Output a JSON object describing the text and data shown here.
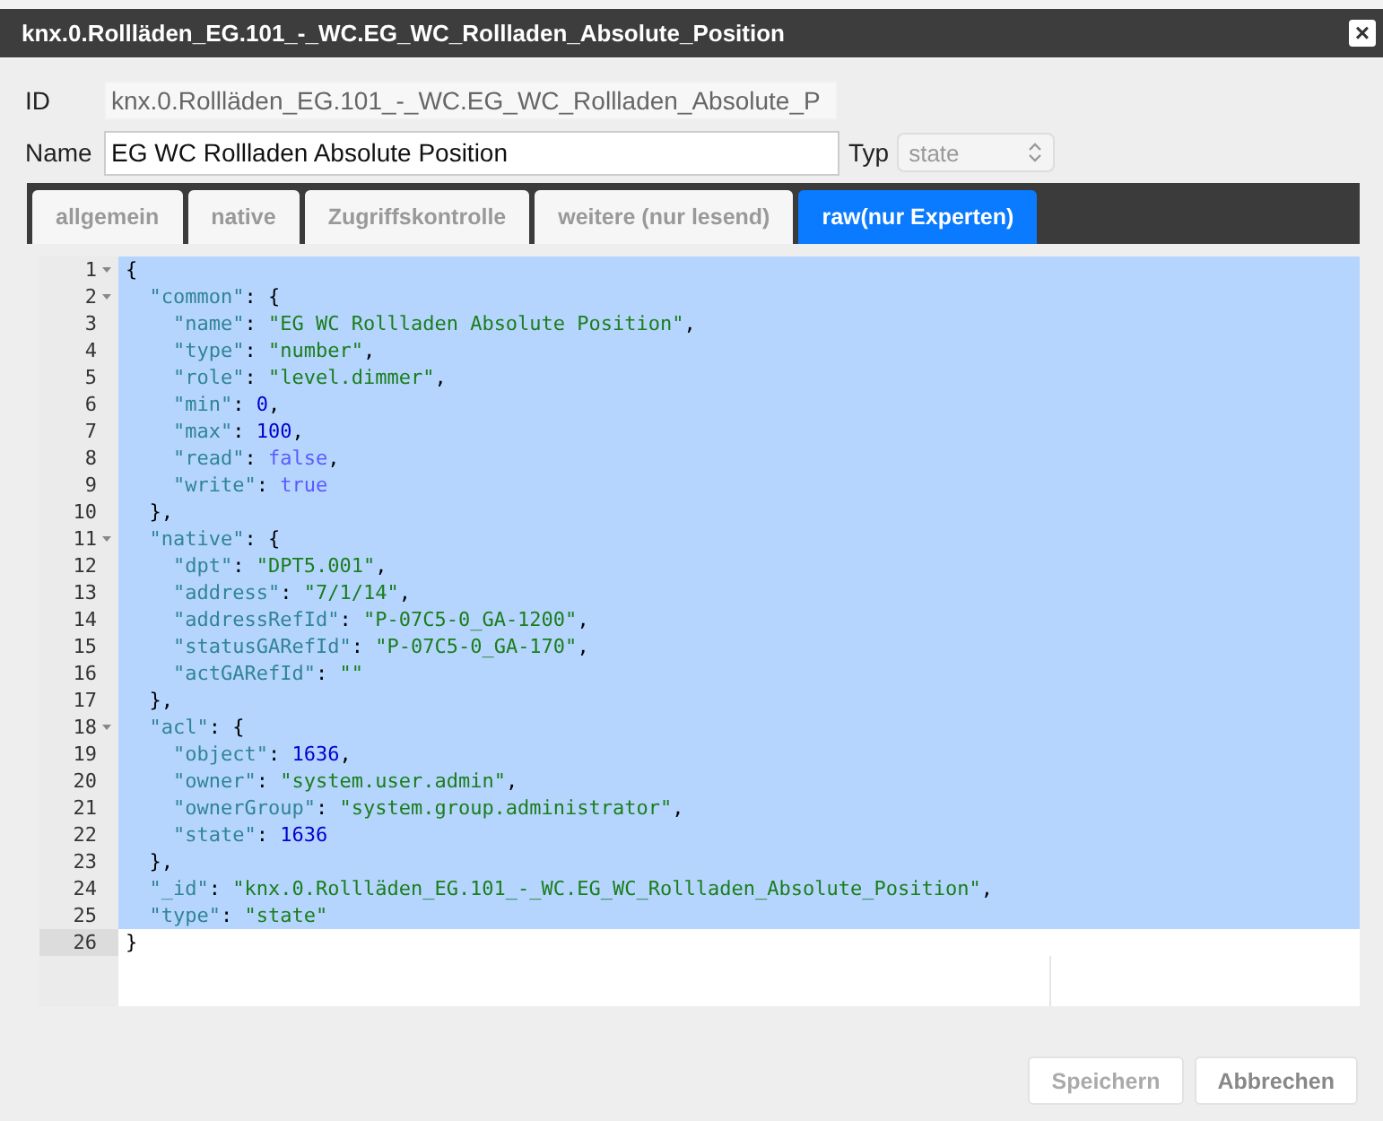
{
  "window": {
    "title": "knx.0.Rollläden_EG.101_-_WC.EG_WC_Rollladen_Absolute_Position",
    "close": "×"
  },
  "id_field": {
    "label": "ID",
    "value": "knx.0.Rollläden_EG.101_-_WC.EG_WC_Rollladen_Absolute_P"
  },
  "name_field": {
    "label": "Name",
    "value": "EG WC Rollladen Absolute Position"
  },
  "type_select": {
    "label": "Typ",
    "value": "state"
  },
  "tabs": [
    {
      "label": "allgemein",
      "selected": false
    },
    {
      "label": "native",
      "selected": false
    },
    {
      "label": "Zugriffskontrolle",
      "selected": false
    },
    {
      "label": "weitere (nur lesend)",
      "selected": false
    },
    {
      "label": "raw(nur Experten)",
      "selected": true
    }
  ],
  "editor": {
    "lines": [
      {
        "number": "1",
        "fold": true,
        "selected": true,
        "current": false,
        "tokens": [
          {
            "kind": "punct",
            "text": "{"
          }
        ]
      },
      {
        "number": "2",
        "fold": true,
        "selected": true,
        "current": false,
        "tokens": [
          {
            "kind": "key",
            "text": "  \"common\""
          },
          {
            "kind": "punct",
            "text": ": {"
          }
        ]
      },
      {
        "number": "3",
        "fold": false,
        "selected": true,
        "current": false,
        "tokens": [
          {
            "kind": "key",
            "text": "    \"name\""
          },
          {
            "kind": "punct",
            "text": ": "
          },
          {
            "kind": "string",
            "text": "\"EG WC Rollladen Absolute Position\""
          },
          {
            "kind": "punct",
            "text": ","
          }
        ]
      },
      {
        "number": "4",
        "fold": false,
        "selected": true,
        "current": false,
        "tokens": [
          {
            "kind": "key",
            "text": "    \"type\""
          },
          {
            "kind": "punct",
            "text": ": "
          },
          {
            "kind": "string",
            "text": "\"number\""
          },
          {
            "kind": "punct",
            "text": ","
          }
        ]
      },
      {
        "number": "5",
        "fold": false,
        "selected": true,
        "current": false,
        "tokens": [
          {
            "kind": "key",
            "text": "    \"role\""
          },
          {
            "kind": "punct",
            "text": ": "
          },
          {
            "kind": "string",
            "text": "\"level.dimmer\""
          },
          {
            "kind": "punct",
            "text": ","
          }
        ]
      },
      {
        "number": "6",
        "fold": false,
        "selected": true,
        "current": false,
        "tokens": [
          {
            "kind": "key",
            "text": "    \"min\""
          },
          {
            "kind": "punct",
            "text": ": "
          },
          {
            "kind": "number",
            "text": "0"
          },
          {
            "kind": "punct",
            "text": ","
          }
        ]
      },
      {
        "number": "7",
        "fold": false,
        "selected": true,
        "current": false,
        "tokens": [
          {
            "kind": "key",
            "text": "    \"max\""
          },
          {
            "kind": "punct",
            "text": ": "
          },
          {
            "kind": "number",
            "text": "100"
          },
          {
            "kind": "punct",
            "text": ","
          }
        ]
      },
      {
        "number": "8",
        "fold": false,
        "selected": true,
        "current": false,
        "tokens": [
          {
            "kind": "key",
            "text": "    \"read\""
          },
          {
            "kind": "punct",
            "text": ": "
          },
          {
            "kind": "bool",
            "text": "false"
          },
          {
            "kind": "punct",
            "text": ","
          }
        ]
      },
      {
        "number": "9",
        "fold": false,
        "selected": true,
        "current": false,
        "tokens": [
          {
            "kind": "key",
            "text": "    \"write\""
          },
          {
            "kind": "punct",
            "text": ": "
          },
          {
            "kind": "bool",
            "text": "true"
          }
        ]
      },
      {
        "number": "10",
        "fold": false,
        "selected": true,
        "current": false,
        "tokens": [
          {
            "kind": "punct",
            "text": "  },"
          }
        ]
      },
      {
        "number": "11",
        "fold": true,
        "selected": true,
        "current": false,
        "tokens": [
          {
            "kind": "key",
            "text": "  \"native\""
          },
          {
            "kind": "punct",
            "text": ": {"
          }
        ]
      },
      {
        "number": "12",
        "fold": false,
        "selected": true,
        "current": false,
        "tokens": [
          {
            "kind": "key",
            "text": "    \"dpt\""
          },
          {
            "kind": "punct",
            "text": ": "
          },
          {
            "kind": "string",
            "text": "\"DPT5.001\""
          },
          {
            "kind": "punct",
            "text": ","
          }
        ]
      },
      {
        "number": "13",
        "fold": false,
        "selected": true,
        "current": false,
        "tokens": [
          {
            "kind": "key",
            "text": "    \"address\""
          },
          {
            "kind": "punct",
            "text": ": "
          },
          {
            "kind": "string",
            "text": "\"7/1/14\""
          },
          {
            "kind": "punct",
            "text": ","
          }
        ]
      },
      {
        "number": "14",
        "fold": false,
        "selected": true,
        "current": false,
        "tokens": [
          {
            "kind": "key",
            "text": "    \"addressRefId\""
          },
          {
            "kind": "punct",
            "text": ": "
          },
          {
            "kind": "string",
            "text": "\"P-07C5-0_GA-1200\""
          },
          {
            "kind": "punct",
            "text": ","
          }
        ]
      },
      {
        "number": "15",
        "fold": false,
        "selected": true,
        "current": false,
        "tokens": [
          {
            "kind": "key",
            "text": "    \"statusGARefId\""
          },
          {
            "kind": "punct",
            "text": ": "
          },
          {
            "kind": "string",
            "text": "\"P-07C5-0_GA-170\""
          },
          {
            "kind": "punct",
            "text": ","
          }
        ]
      },
      {
        "number": "16",
        "fold": false,
        "selected": true,
        "current": false,
        "tokens": [
          {
            "kind": "key",
            "text": "    \"actGARefId\""
          },
          {
            "kind": "punct",
            "text": ": "
          },
          {
            "kind": "string",
            "text": "\"\""
          }
        ]
      },
      {
        "number": "17",
        "fold": false,
        "selected": true,
        "current": false,
        "tokens": [
          {
            "kind": "punct",
            "text": "  },"
          }
        ]
      },
      {
        "number": "18",
        "fold": true,
        "selected": true,
        "current": false,
        "tokens": [
          {
            "kind": "key",
            "text": "  \"acl\""
          },
          {
            "kind": "punct",
            "text": ": {"
          }
        ]
      },
      {
        "number": "19",
        "fold": false,
        "selected": true,
        "current": false,
        "tokens": [
          {
            "kind": "key",
            "text": "    \"object\""
          },
          {
            "kind": "punct",
            "text": ": "
          },
          {
            "kind": "number",
            "text": "1636"
          },
          {
            "kind": "punct",
            "text": ","
          }
        ]
      },
      {
        "number": "20",
        "fold": false,
        "selected": true,
        "current": false,
        "tokens": [
          {
            "kind": "key",
            "text": "    \"owner\""
          },
          {
            "kind": "punct",
            "text": ": "
          },
          {
            "kind": "string",
            "text": "\"system.user.admin\""
          },
          {
            "kind": "punct",
            "text": ","
          }
        ]
      },
      {
        "number": "21",
        "fold": false,
        "selected": true,
        "current": false,
        "tokens": [
          {
            "kind": "key",
            "text": "    \"ownerGroup\""
          },
          {
            "kind": "punct",
            "text": ": "
          },
          {
            "kind": "string",
            "text": "\"system.group.administrator\""
          },
          {
            "kind": "punct",
            "text": ","
          }
        ]
      },
      {
        "number": "22",
        "fold": false,
        "selected": true,
        "current": false,
        "tokens": [
          {
            "kind": "key",
            "text": "    \"state\""
          },
          {
            "kind": "punct",
            "text": ": "
          },
          {
            "kind": "number",
            "text": "1636"
          }
        ]
      },
      {
        "number": "23",
        "fold": false,
        "selected": true,
        "current": false,
        "tokens": [
          {
            "kind": "punct",
            "text": "  },"
          }
        ]
      },
      {
        "number": "24",
        "fold": false,
        "selected": true,
        "current": false,
        "tokens": [
          {
            "kind": "key",
            "text": "  \"_id\""
          },
          {
            "kind": "punct",
            "text": ": "
          },
          {
            "kind": "string",
            "text": "\"knx.0.Rollläden_EG.101_-_WC.EG_WC_Rollladen_Absolute_Position\""
          },
          {
            "kind": "punct",
            "text": ","
          }
        ]
      },
      {
        "number": "25",
        "fold": false,
        "selected": true,
        "current": false,
        "tokens": [
          {
            "kind": "key",
            "text": "  \"type\""
          },
          {
            "kind": "punct",
            "text": ": "
          },
          {
            "kind": "string",
            "text": "\"state\""
          }
        ]
      },
      {
        "number": "26",
        "fold": false,
        "selected": false,
        "current": true,
        "tokens": [
          {
            "kind": "punct",
            "text": "}"
          }
        ]
      }
    ]
  },
  "buttons": [
    {
      "label": "Speichern",
      "disabled": true
    },
    {
      "label": "Abbrechen",
      "disabled": false
    }
  ]
}
